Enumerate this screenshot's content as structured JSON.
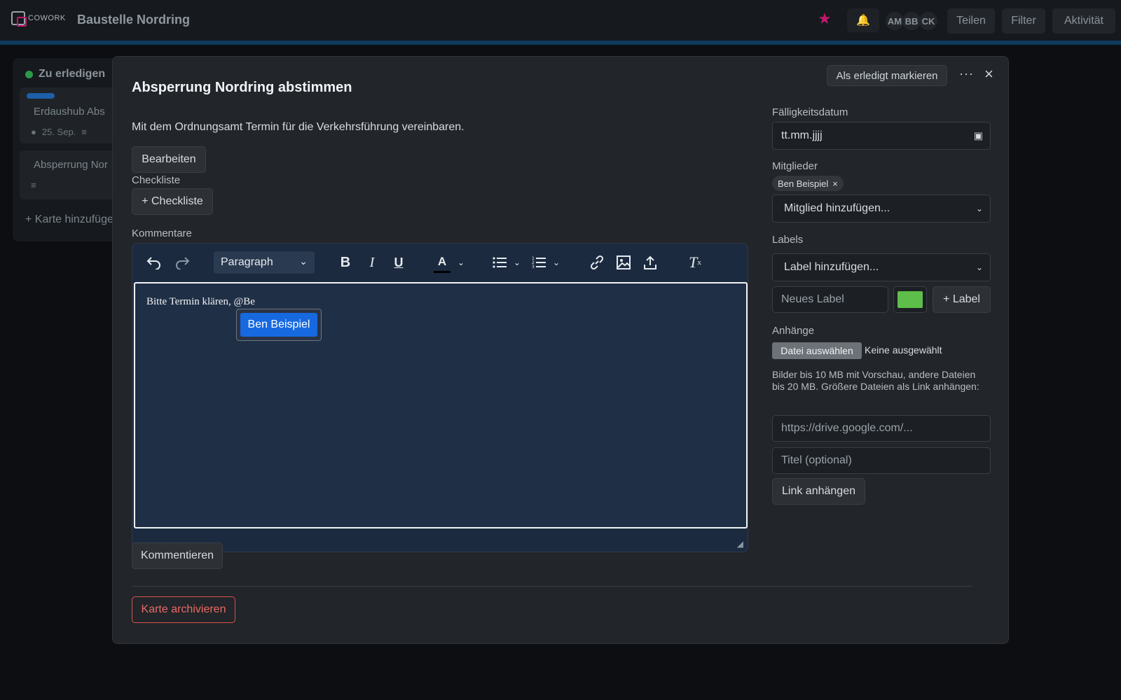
{
  "app": {
    "logo_text": "COWORK",
    "board_title": "Baustelle Nordring",
    "members": [
      "AM",
      "BB",
      "CK"
    ],
    "buttons": {
      "share": "Teilen",
      "filter": "Filter",
      "activity": "Aktivität"
    }
  },
  "list": {
    "title": "Zu erledigen",
    "cards": [
      {
        "title": "Erdaushub Abs",
        "date": "25. Sep."
      },
      {
        "title": "Absperrung Nor"
      }
    ],
    "add_card": "+ Karte hinzufüge"
  },
  "modal": {
    "title": "Absperrung Nordring abstimmen",
    "mark_done": "Als erledigt markieren",
    "more": "···",
    "close": "×",
    "description": "Mit dem Ordnungsamt Termin für die Verkehrsführung vereinbaren.",
    "edit_button": "Bearbeiten",
    "checklist_label": "Checkliste",
    "checklist_button": "+ Checkliste",
    "comments_label": "Kommentare",
    "editor": {
      "block_format": "Paragraph",
      "content": "Bitte Termin klären, @Be",
      "mention_suggestion": "Ben Beispiel"
    },
    "comment_button": "Kommentieren",
    "archive_button": "Karte archivieren",
    "sidebar": {
      "due_label": "Fälligkeitsdatum",
      "due_placeholder": "tt.mm.jjjj",
      "members_label": "Mitglieder",
      "member_chip": "Ben Beispiel",
      "member_select": "Mitglied hinzufügen...",
      "labels_label": "Labels",
      "label_select": "Label hinzufügen...",
      "new_label_placeholder": "Neues Label",
      "label_color": "#5dbf4a",
      "add_label_button": "+ Label",
      "attachments_label": "Anhänge",
      "file_button": "Datei auswählen",
      "file_none": "Keine ausgewählt",
      "attachment_hint": "Bilder bis 10 MB mit Vorschau, andere Dateien bis 20 MB. Größere Dateien als Link anhängen:",
      "link_placeholder": "https://drive.google.com/...",
      "link_title_placeholder": "Titel (optional)",
      "attach_link_button": "Link anhängen"
    }
  },
  "colors": {
    "accent_star": "#c0186b",
    "mention_highlight": "#1769e0",
    "archive": "#ea6b66"
  }
}
